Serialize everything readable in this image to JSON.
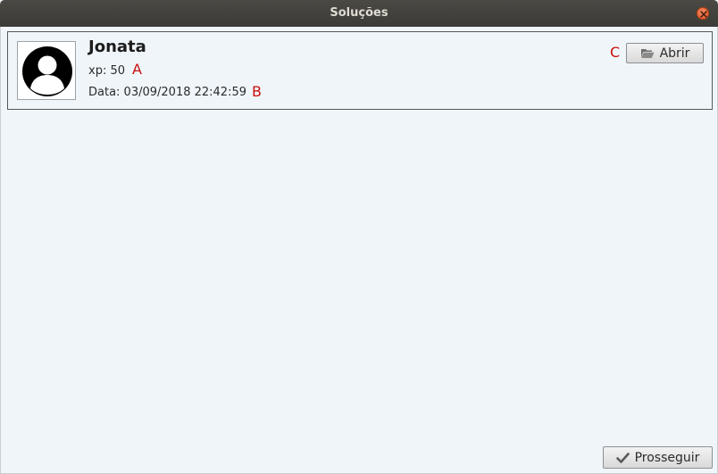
{
  "window": {
    "title": "Soluções"
  },
  "solution": {
    "name": "Jonata",
    "xp_text": "xp: 50",
    "date_text": "Data: 03/09/2018 22:42:59"
  },
  "annotations": {
    "a": "A",
    "b": "B",
    "c": "C"
  },
  "buttons": {
    "open_label": "Abrir",
    "proceed_label": "Prosseguir"
  },
  "icons": {
    "close": "close-icon",
    "avatar": "user-avatar-icon",
    "open": "folder-open-icon",
    "proceed": "checkmark-icon"
  },
  "colors": {
    "annotation": "#c8100e",
    "close_button": "#e0511f",
    "titlebar": "#3c3b37"
  }
}
